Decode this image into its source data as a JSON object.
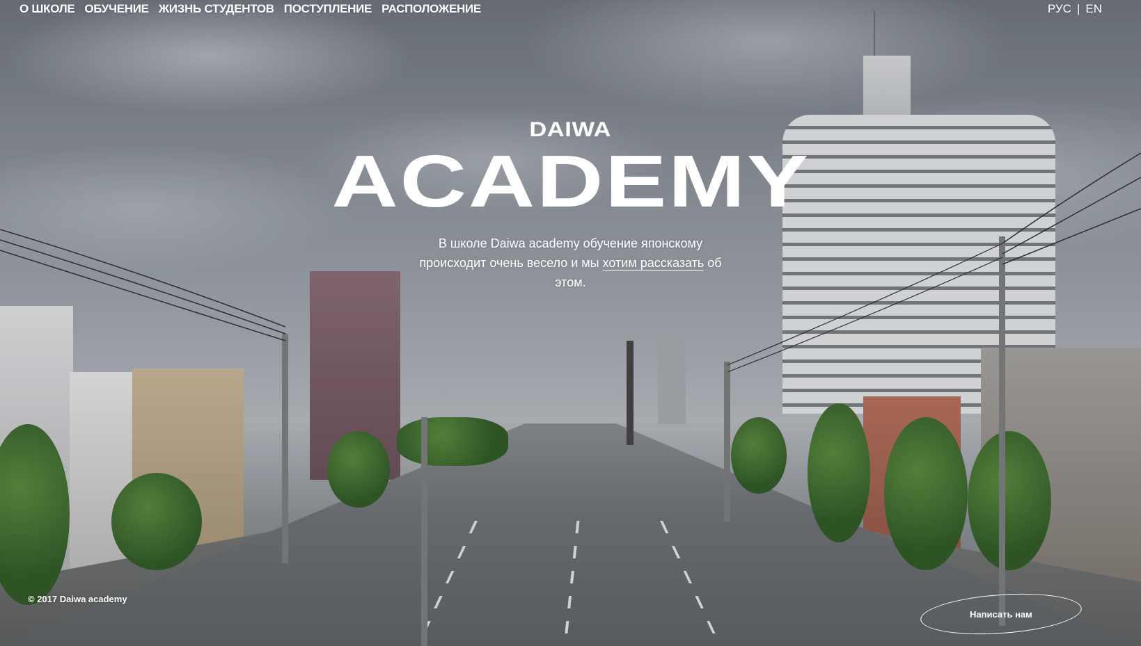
{
  "nav": {
    "items": [
      {
        "label": "О ШКОЛЕ"
      },
      {
        "label": "ОБУЧЕНИЕ"
      },
      {
        "label": "ЖИЗНЬ СТУДЕНТОВ"
      },
      {
        "label": "ПОСТУПЛЕНИЕ"
      },
      {
        "label": "РАСПОЛОЖЕНИЕ"
      }
    ]
  },
  "lang": {
    "ru": "РУС",
    "separator": "|",
    "en": "EN"
  },
  "hero": {
    "brand_small": "DAIWA",
    "brand_big": "ACADEMY",
    "tagline_before": "В школе Daiwa academy обучение японскому происходит очень весело и мы ",
    "tagline_link": "хотим рассказать",
    "tagline_after": " об этом."
  },
  "footer": {
    "copyright": "© 2017 Daiwa academy",
    "write_button": "Написать нам"
  },
  "background": {
    "description_icon": "city-street-photo"
  }
}
